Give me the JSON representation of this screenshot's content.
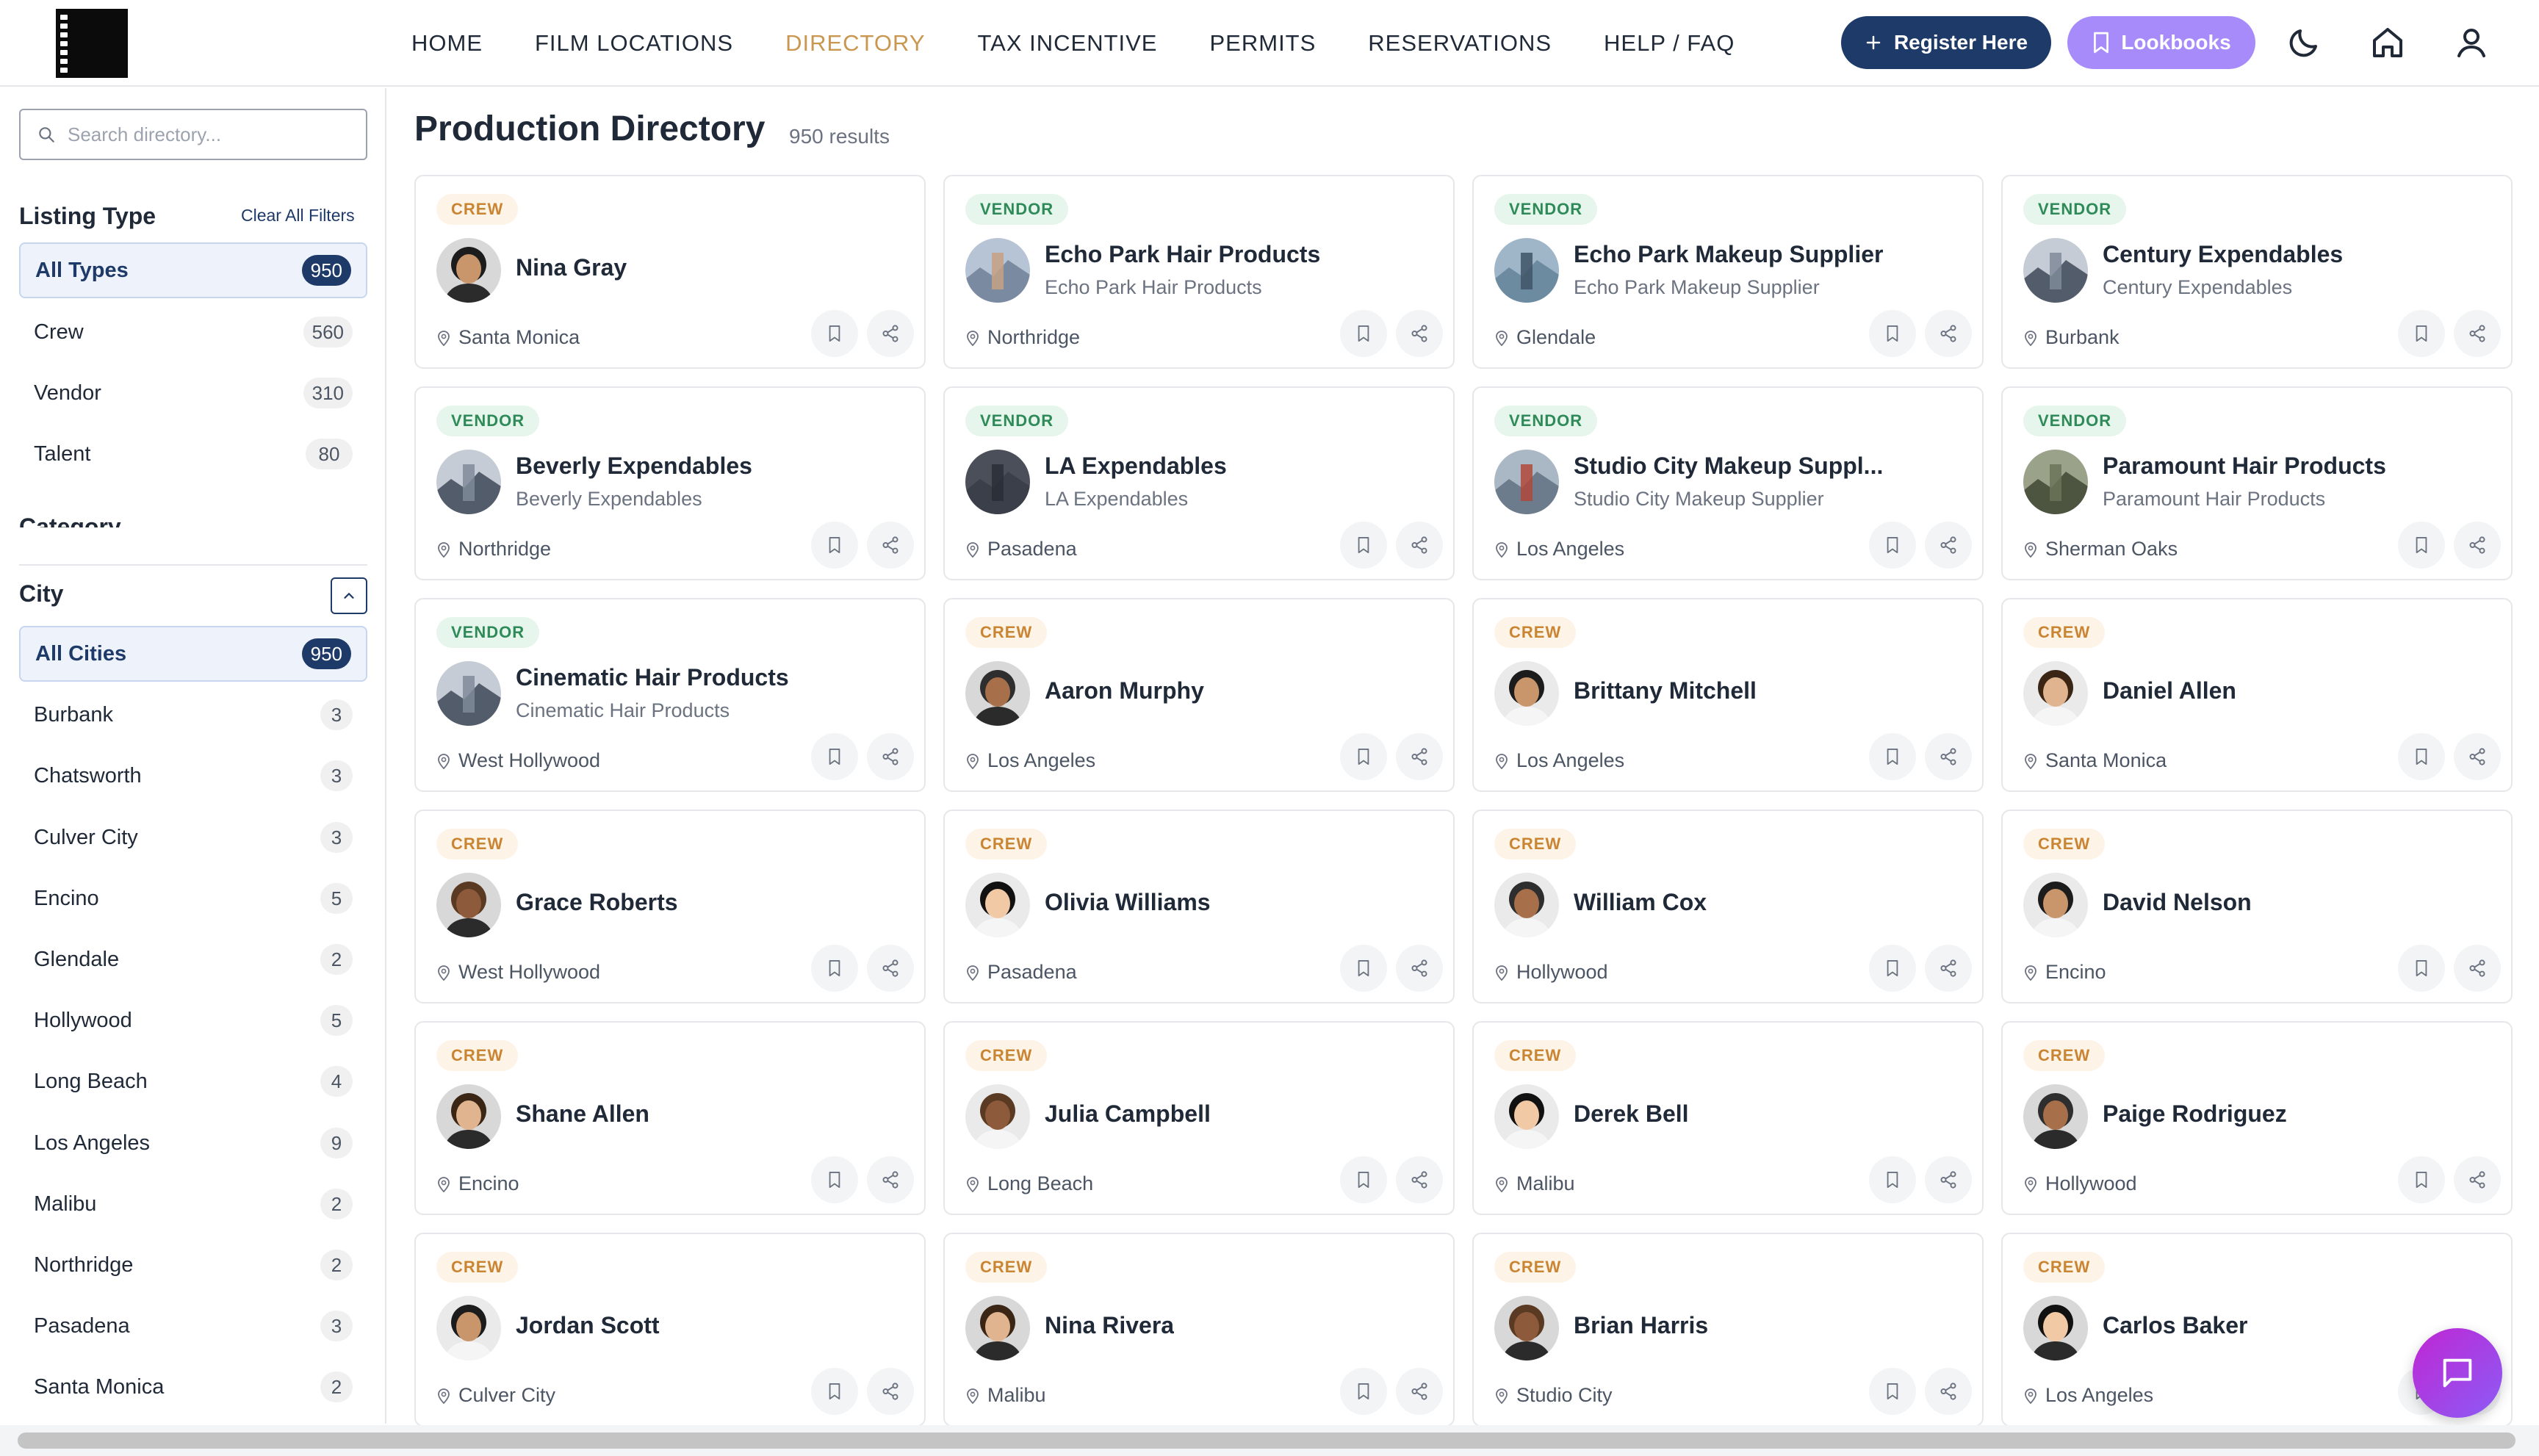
{
  "nav": {
    "items": [
      "HOME",
      "FILM LOCATIONS",
      "DIRECTORY",
      "TAX INCENTIVE",
      "PERMITS",
      "RESERVATIONS",
      "HELP / FAQ"
    ],
    "active": "DIRECTORY",
    "register_label": "Register Here",
    "lookbooks_label": "Lookbooks",
    "accent_color": "#c9974f",
    "brand_color": "#1e3a68",
    "lookbooks_color": "#a78bfa"
  },
  "sidebar": {
    "search_placeholder": "Search directory...",
    "listing_type_title": "Listing Type",
    "clear_all": "Clear All Filters",
    "listing_types": [
      {
        "label": "All Types",
        "count": "950",
        "selected": true
      },
      {
        "label": "Crew",
        "count": "560",
        "selected": false
      },
      {
        "label": "Vendor",
        "count": "310",
        "selected": false
      },
      {
        "label": "Talent",
        "count": "80",
        "selected": false
      }
    ],
    "category_title": "Category",
    "city_title": "City",
    "cities": [
      {
        "label": "All Cities",
        "count": "950",
        "selected": true
      },
      {
        "label": "Burbank",
        "count": "3",
        "selected": false
      },
      {
        "label": "Chatsworth",
        "count": "3",
        "selected": false
      },
      {
        "label": "Culver City",
        "count": "3",
        "selected": false
      },
      {
        "label": "Encino",
        "count": "5",
        "selected": false
      },
      {
        "label": "Glendale",
        "count": "2",
        "selected": false
      },
      {
        "label": "Hollywood",
        "count": "5",
        "selected": false
      },
      {
        "label": "Long Beach",
        "count": "4",
        "selected": false
      },
      {
        "label": "Los Angeles",
        "count": "9",
        "selected": false
      },
      {
        "label": "Malibu",
        "count": "2",
        "selected": false
      },
      {
        "label": "Northridge",
        "count": "2",
        "selected": false
      },
      {
        "label": "Pasadena",
        "count": "3",
        "selected": false
      },
      {
        "label": "Santa Monica",
        "count": "2",
        "selected": false
      }
    ]
  },
  "main": {
    "title": "Production Directory",
    "results": "950 results",
    "cards": [
      {
        "type": "CREW",
        "name": "Nina Gray",
        "sub": "",
        "location": "Santa Monica",
        "avatar": "person"
      },
      {
        "type": "VENDOR",
        "name": "Echo Park Hair Products",
        "sub": "Echo Park Hair Products",
        "location": "Northridge",
        "avatar": "tower"
      },
      {
        "type": "VENDOR",
        "name": "Echo Park Makeup Supplier",
        "sub": "Echo Park Makeup Supplier",
        "location": "Glendale",
        "avatar": "lake"
      },
      {
        "type": "VENDOR",
        "name": "Century Expendables",
        "sub": "Century Expendables",
        "location": "Burbank",
        "avatar": "city"
      },
      {
        "type": "VENDOR",
        "name": "Beverly Expendables",
        "sub": "Beverly Expendables",
        "location": "Northridge",
        "avatar": "city"
      },
      {
        "type": "VENDOR",
        "name": "LA Expendables",
        "sub": "LA Expendables",
        "location": "Pasadena",
        "avatar": "night"
      },
      {
        "type": "VENDOR",
        "name": "Studio City Makeup Suppl...",
        "sub": "Studio City Makeup Supplier",
        "location": "Los Angeles",
        "avatar": "bridge"
      },
      {
        "type": "VENDOR",
        "name": "Paramount Hair Products",
        "sub": "Paramount Hair Products",
        "location": "Sherman Oaks",
        "avatar": "hill"
      },
      {
        "type": "VENDOR",
        "name": "Cinematic Hair Products",
        "sub": "Cinematic Hair Products",
        "location": "West Hollywood",
        "avatar": "city"
      },
      {
        "type": "CREW",
        "name": "Aaron Murphy",
        "sub": "",
        "location": "Los Angeles",
        "avatar": "person"
      },
      {
        "type": "CREW",
        "name": "Brittany Mitchell",
        "sub": "",
        "location": "Los Angeles",
        "avatar": "person2"
      },
      {
        "type": "CREW",
        "name": "Daniel Allen",
        "sub": "",
        "location": "Santa Monica",
        "avatar": "person2"
      },
      {
        "type": "CREW",
        "name": "Grace Roberts",
        "sub": "",
        "location": "West Hollywood",
        "avatar": "person"
      },
      {
        "type": "CREW",
        "name": "Olivia Williams",
        "sub": "",
        "location": "Pasadena",
        "avatar": "person2"
      },
      {
        "type": "CREW",
        "name": "William Cox",
        "sub": "",
        "location": "Hollywood",
        "avatar": "person2"
      },
      {
        "type": "CREW",
        "name": "David Nelson",
        "sub": "",
        "location": "Encino",
        "avatar": "person2"
      },
      {
        "type": "CREW",
        "name": "Shane Allen",
        "sub": "",
        "location": "Encino",
        "avatar": "person"
      },
      {
        "type": "CREW",
        "name": "Julia Campbell",
        "sub": "",
        "location": "Long Beach",
        "avatar": "person2"
      },
      {
        "type": "CREW",
        "name": "Derek Bell",
        "sub": "",
        "location": "Malibu",
        "avatar": "person2"
      },
      {
        "type": "CREW",
        "name": "Paige Rodriguez",
        "sub": "",
        "location": "Hollywood",
        "avatar": "person"
      },
      {
        "type": "CREW",
        "name": "Jordan Scott",
        "sub": "",
        "location": "Culver City",
        "avatar": "person2"
      },
      {
        "type": "CREW",
        "name": "Nina Rivera",
        "sub": "",
        "location": "Malibu",
        "avatar": "person"
      },
      {
        "type": "CREW",
        "name": "Brian Harris",
        "sub": "",
        "location": "Studio City",
        "avatar": "person"
      },
      {
        "type": "CREW",
        "name": "Carlos Baker",
        "sub": "",
        "location": "Los Angeles",
        "avatar": "person"
      }
    ]
  }
}
